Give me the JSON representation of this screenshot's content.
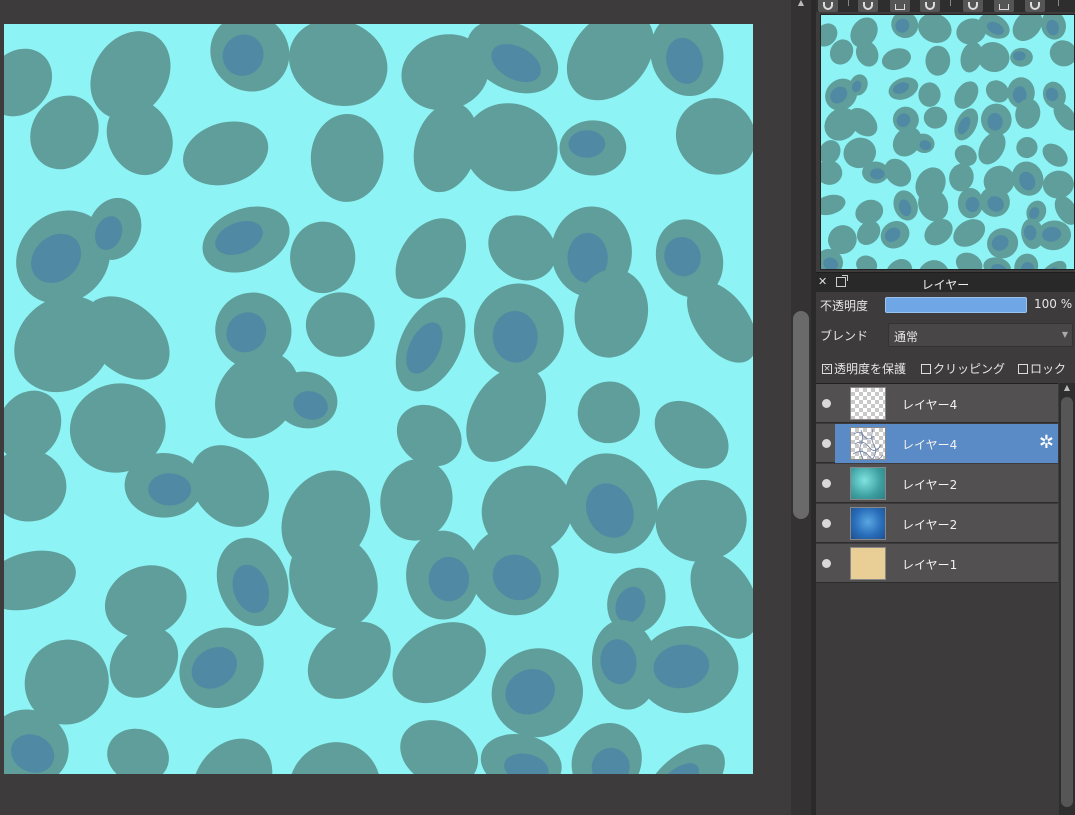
{
  "navigator": {
    "tools": [
      "zoom-fit-icon",
      "zoom-in-icon",
      "fit-window-icon",
      "zoom-out-icon",
      "record-icon",
      "flip-icon",
      "rotate-icon"
    ]
  },
  "layer_panel": {
    "title": "レイヤー",
    "opacity_label": "不透明度",
    "opacity_value": "100 %",
    "opacity_fraction": 1.0,
    "blend_label": "ブレンド",
    "blend_value": "通常",
    "checkboxes": [
      {
        "label": "透明度を保護",
        "checked": true
      },
      {
        "label": "クリッピング",
        "checked": false
      },
      {
        "label": "ロック",
        "checked": false
      }
    ],
    "layers": [
      {
        "name": "レイヤー4",
        "visible": true,
        "selected": false,
        "thumb": "transparent"
      },
      {
        "name": "レイヤー4",
        "visible": true,
        "selected": true,
        "thumb": "sketch"
      },
      {
        "name": "レイヤー2",
        "visible": true,
        "selected": false,
        "thumb": "teal"
      },
      {
        "name": "レイヤー2",
        "visible": true,
        "selected": false,
        "thumb": "blue"
      },
      {
        "name": "レイヤー1",
        "visible": true,
        "selected": false,
        "thumb": "beige"
      }
    ]
  },
  "colors": {
    "canvas_light": "#8ef3f4",
    "canvas_stone": "#5f9e9a",
    "canvas_shadow": "#3f6fb0",
    "selection": "#5a8bc7",
    "opacity_bar": "#6fa6e6",
    "layer1_fill": "#e9cf96"
  }
}
